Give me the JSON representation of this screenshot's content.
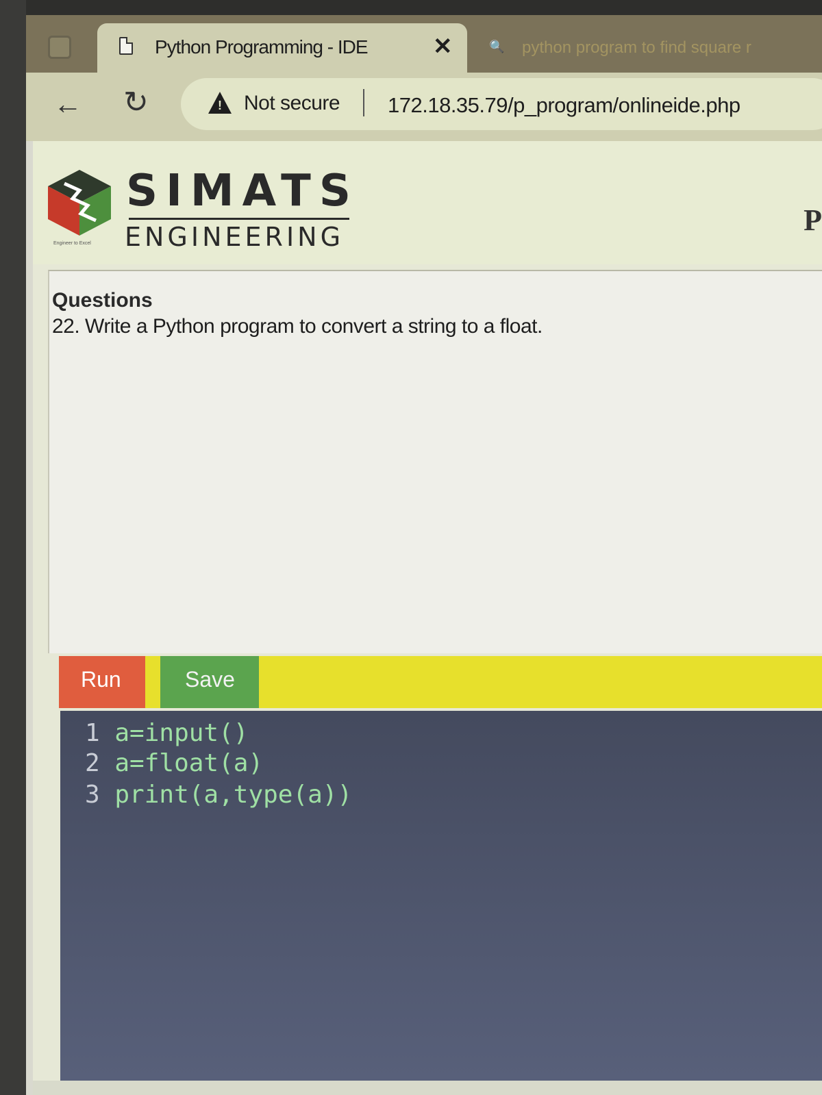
{
  "browser": {
    "active_tab": {
      "title": "Python Programming - IDE",
      "close_glyph": "✕",
      "icon": "document-icon"
    },
    "inactive_tab": {
      "title": "python program to find square r",
      "icon": "search-icon"
    },
    "back_glyph": "←",
    "reload_glyph": "↻",
    "security_label": "Not secure",
    "url": "172.18.35.79/p_program/onlineide.php"
  },
  "header": {
    "logo_title": "SIMATS",
    "logo_subtitle": "ENGINEERING",
    "logo_tagline": "Engineer to Excel",
    "right_letter": "P"
  },
  "question": {
    "heading": "Questions",
    "text": "22. Write a Python program to convert a string to a float."
  },
  "toolbar": {
    "run_label": "Run",
    "save_label": "Save"
  },
  "editor": {
    "lines": [
      {
        "number": "1",
        "code": "a=input()"
      },
      {
        "number": "2",
        "code": "a=float(a)"
      },
      {
        "number": "3",
        "code": "print(a,type(a))"
      }
    ]
  },
  "colors": {
    "run": "#e05d3e",
    "save": "#5ba44e",
    "toolbar": "#e7e02c",
    "editor_bg": "#4b5166",
    "code_text": "#9fe0a4"
  }
}
